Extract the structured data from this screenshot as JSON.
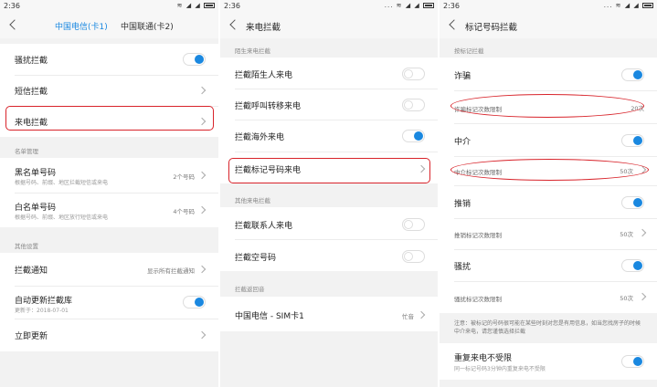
{
  "status": {
    "time": "2:36",
    "icons": "... ≋ ◢ ◢",
    "icons_short": "≋ ◢ ◢"
  },
  "panel1": {
    "tabs": [
      "中国电信(卡1)",
      "中国联通(卡2)"
    ],
    "harass": "骚扰拦截",
    "sms": "短信拦截",
    "call": "来电拦截",
    "list_header": "名单管理",
    "blacklist": {
      "label": "黑名单号码",
      "sub": "根据号码、前缀、地区拦截短信或来电",
      "value": "2个号码"
    },
    "whitelist": {
      "label": "白名单号码",
      "sub": "根据号码、前缀、地区放行短信或来电",
      "value": "4个号码"
    },
    "other_header": "其他设置",
    "notify": {
      "label": "拦截通知",
      "value": "显示所有拦截通知"
    },
    "autoupdate": {
      "label": "自动更新拦截库",
      "sub": "更新于：2018-07-01"
    },
    "update_now": "立即更新"
  },
  "panel2": {
    "title": "来电拦截",
    "stranger_header": "陌生来电拦截",
    "stranger": "拦截陌生人来电",
    "forward": "拦截呼叫转移来电",
    "overseas": "拦截海外来电",
    "marked": "拦截标记号码来电",
    "other_header": "其他来电拦截",
    "contacts": "拦截联系人来电",
    "empty": "拦截空号码",
    "tone_header": "拦截返回音",
    "sim": {
      "label": "中国电信 - SIM卡1",
      "value": "忙音"
    }
  },
  "panel3": {
    "title": "标记号码拦截",
    "header": "按标记拦截",
    "fraud": "诈骗",
    "fraud_count": {
      "label": "诈骗标记次数限制",
      "value": "20次"
    },
    "agent": "中介",
    "agent_count": {
      "label": "中介标记次数限制",
      "value": "50次"
    },
    "promo": "推销",
    "promo_count": {
      "label": "推销标记次数限制",
      "value": "50次"
    },
    "harass": "骚扰",
    "harass_count": {
      "label": "骚扰标记次数限制",
      "value": "50次"
    },
    "note": "注意：被标记的号码很可能在某些时刻对您是有用信息，如当您找房子的时候中介来电，请您谨慎选择拦截",
    "repeat": {
      "label": "重复来电不受限",
      "sub": "同一标记号码3分钟内重复来电不受限"
    }
  },
  "colors": {
    "accent": "#1a88e0",
    "highlight": "#d8232a"
  }
}
